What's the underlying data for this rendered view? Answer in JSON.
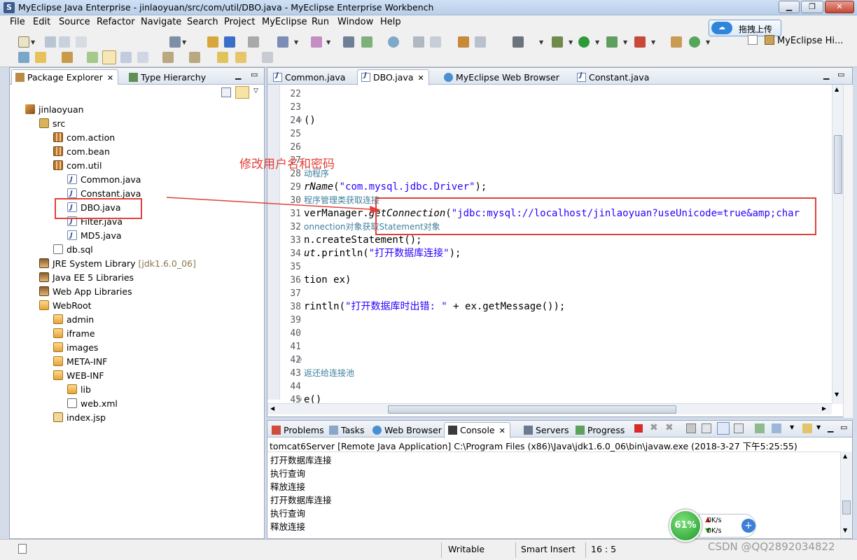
{
  "window": {
    "title": "MyEclipse Java Enterprise - jinlaoyuan/src/com/util/DBO.java - MyEclipse Enterprise Workbench"
  },
  "menu": [
    "File",
    "Edit",
    "Source",
    "Refactor",
    "Navigate",
    "Search",
    "Project",
    "MyEclipse",
    "Run",
    "Window",
    "Help"
  ],
  "cloud_upload": {
    "label": "拖拽上传"
  },
  "perspective": {
    "label": "MyEclipse Hi..."
  },
  "explorer": {
    "tabs": [
      "Package Explorer",
      "Type Hierarchy"
    ],
    "tree": [
      {
        "label": "jinlaoyuan",
        "icon": "project-icon"
      },
      {
        "label": "src",
        "icon": "source-folder-icon"
      },
      {
        "label": "com.action",
        "icon": "package-icon"
      },
      {
        "label": "com.bean",
        "icon": "package-icon"
      },
      {
        "label": "com.util",
        "icon": "package-icon"
      },
      {
        "label": "Common.java",
        "icon": "java-file-icon"
      },
      {
        "label": "Constant.java",
        "icon": "java-file-icon"
      },
      {
        "label": "DBO.java",
        "icon": "java-file-icon"
      },
      {
        "label": "Filter.java",
        "icon": "java-file-icon"
      },
      {
        "label": "MD5.java",
        "icon": "java-file-icon"
      },
      {
        "label": "db.sql",
        "icon": "sql-file-icon"
      },
      {
        "label": "JRE System Library",
        "suffix": "[jdk1.6.0_06]",
        "icon": "library-icon"
      },
      {
        "label": "Java EE 5 Libraries",
        "icon": "library-icon"
      },
      {
        "label": "Web App Libraries",
        "icon": "library-icon"
      },
      {
        "label": "WebRoot",
        "icon": "folder-icon"
      },
      {
        "label": "admin",
        "icon": "folder-icon"
      },
      {
        "label": "iframe",
        "icon": "folder-icon"
      },
      {
        "label": "images",
        "icon": "folder-icon"
      },
      {
        "label": "META-INF",
        "icon": "folder-icon"
      },
      {
        "label": "WEB-INF",
        "icon": "folder-icon"
      },
      {
        "label": "lib",
        "icon": "folder-icon"
      },
      {
        "label": "web.xml",
        "icon": "xml-file-icon"
      },
      {
        "label": "index.jsp",
        "icon": "jsp-file-icon"
      }
    ]
  },
  "editor": {
    "tabs": [
      "Common.java",
      "DBO.java",
      "MyEclipse Web Browser",
      "Constant.java"
    ],
    "active_tab": "DBO.java",
    "lines": [
      {
        "n": "22",
        "parts": []
      },
      {
        "n": "23",
        "parts": []
      },
      {
        "n": "24",
        "parts": [
          {
            "t": "()",
            "c": ""
          }
        ]
      },
      {
        "n": "25",
        "parts": []
      },
      {
        "n": "26",
        "parts": []
      },
      {
        "n": "27",
        "parts": []
      },
      {
        "n": "28",
        "parts": [
          {
            "t": "动程序",
            "c": "cmt"
          }
        ]
      },
      {
        "n": "29",
        "parts": [
          {
            "t": "rName",
            "c": "it"
          },
          {
            "t": "(",
            "c": ""
          },
          {
            "t": "\"com.mysql.jdbc.Driver\"",
            "c": "str"
          },
          {
            "t": ");",
            "c": ""
          }
        ]
      },
      {
        "n": "30",
        "parts": [
          {
            "t": "程序管理类获取连接",
            "c": "cmt"
          }
        ]
      },
      {
        "n": "31",
        "parts": [
          {
            "t": "verManager.",
            "c": ""
          },
          {
            "t": "getConnection",
            "c": "it"
          },
          {
            "t": "(",
            "c": ""
          },
          {
            "t": "\"jdbc:mysql://localhost/jinlaoyuan?useUnicode=true&amp;char",
            "c": "str"
          }
        ]
      },
      {
        "n": "32",
        "parts": [
          {
            "t": "onnection对象获取Statement对象",
            "c": "cmt"
          }
        ]
      },
      {
        "n": "33",
        "parts": [
          {
            "t": "n.createStatement();",
            "c": ""
          }
        ]
      },
      {
        "n": "34",
        "parts": [
          {
            "t": "ut",
            "c": "it"
          },
          {
            "t": ".println(",
            "c": ""
          },
          {
            "t": "\"打开数据库连接\"",
            "c": "str"
          },
          {
            "t": ");",
            "c": ""
          }
        ]
      },
      {
        "n": "35",
        "parts": []
      },
      {
        "n": "36",
        "parts": [
          {
            "t": "tion ex)",
            "c": ""
          }
        ]
      },
      {
        "n": "37",
        "parts": []
      },
      {
        "n": "38",
        "parts": [
          {
            "t": "rintln(",
            "c": ""
          },
          {
            "t": "\"打开数据库时出错: \"",
            "c": "str"
          },
          {
            "t": " + ex.getMessage());",
            "c": ""
          }
        ]
      },
      {
        "n": "39",
        "parts": []
      },
      {
        "n": "40",
        "parts": []
      },
      {
        "n": "41",
        "parts": []
      },
      {
        "n": "42",
        "parts": []
      },
      {
        "n": "43",
        "parts": [
          {
            "t": "返还给连接池",
            "c": "cmt"
          }
        ]
      },
      {
        "n": "44",
        "parts": []
      },
      {
        "n": "45",
        "parts": [
          {
            "t": "e()",
            "c": ""
          }
        ]
      }
    ],
    "fold_lines": [
      "24",
      "42",
      "45"
    ]
  },
  "console": {
    "tabs": [
      "Problems",
      "Tasks",
      "Web Browser",
      "Console",
      "Servers",
      "Progress"
    ],
    "active_tab": "Console",
    "description": "tomcat6Server [Remote Java Application] C:\\Program Files (x86)\\Java\\jdk1.6.0_06\\bin\\javaw.exe (2018-3-27 下午5:25:55)",
    "output": [
      "打开数据库连接",
      "执行查询",
      "释放连接",
      "打开数据库连接",
      "执行查询",
      "释放连接"
    ]
  },
  "annotation": {
    "text": "修改用户名和密码",
    "color": "#e2403a"
  },
  "statusbar": {
    "writable": "Writable",
    "insert_mode": "Smart Insert",
    "position": "16 : 5"
  },
  "network": {
    "percent": "61%",
    "up": "0K/s",
    "down": "0K/s"
  },
  "watermark": "CSDN @QQ2892034822"
}
